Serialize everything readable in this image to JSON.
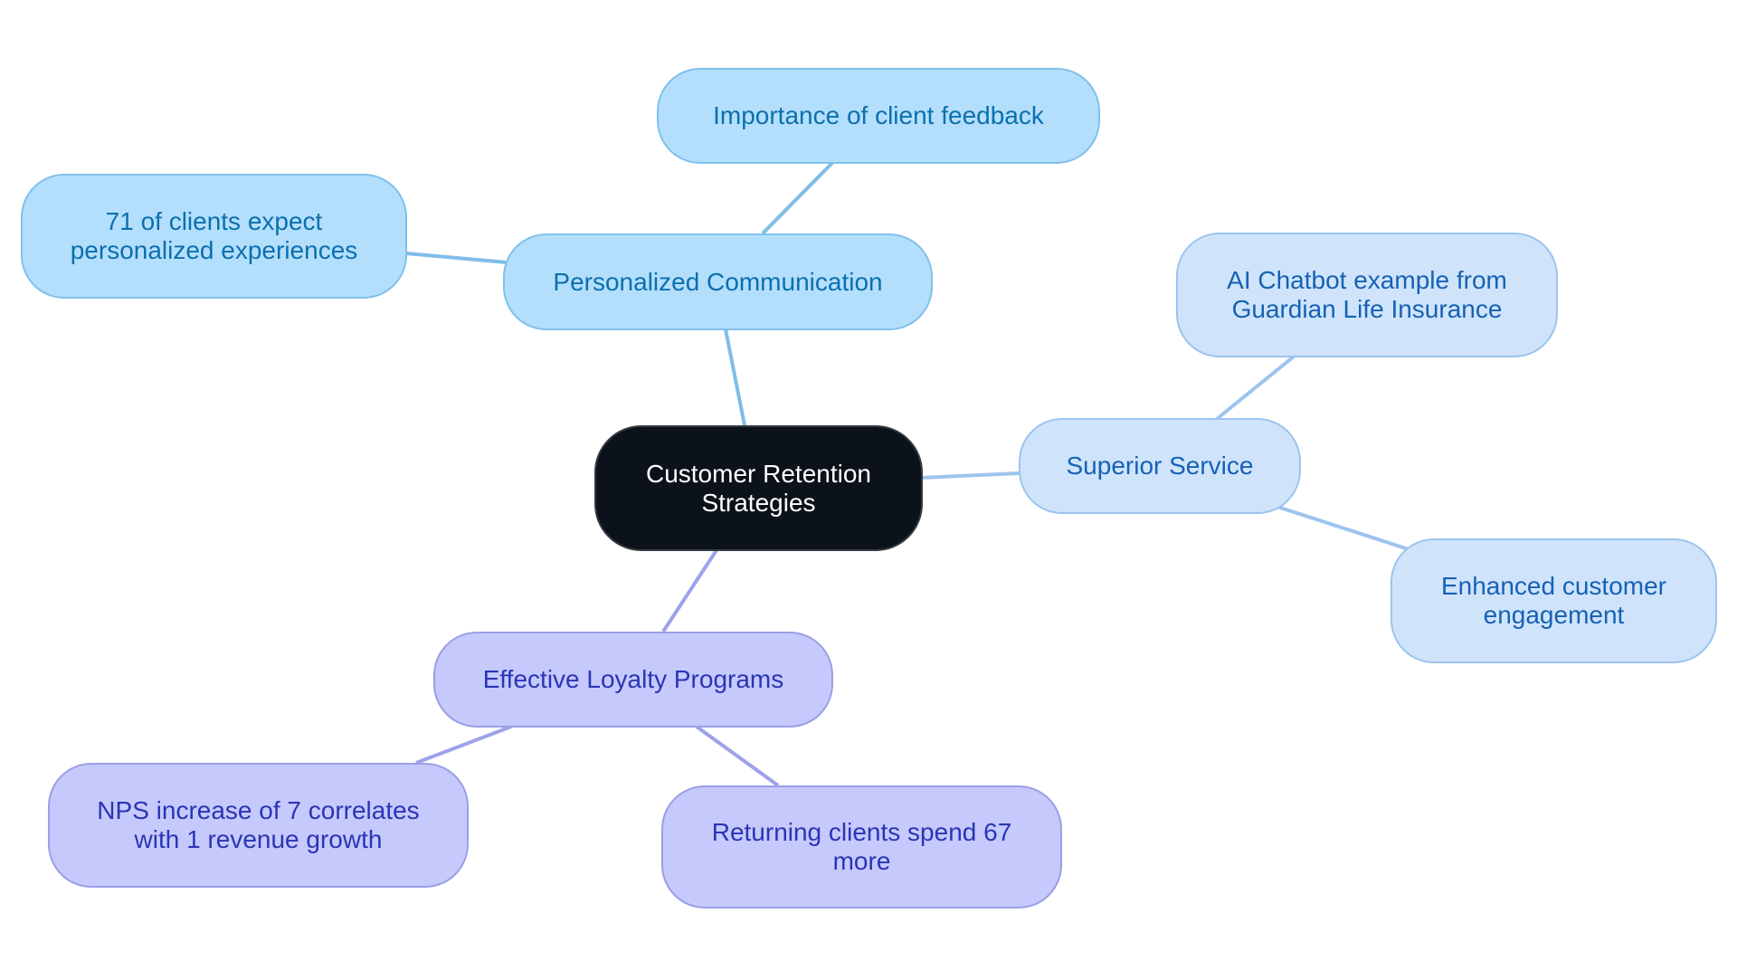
{
  "diagram": {
    "type": "mind-map",
    "root": {
      "id": "root",
      "label": "Customer Retention\nStrategies"
    },
    "colors": {
      "root_fill": "#0c1219",
      "group_personalized": {
        "fill": "#b3dffc",
        "stroke": "#82c0ea",
        "text": "#0c6fae",
        "link": "#7fbde8"
      },
      "group_service": {
        "fill": "#cfe4fb",
        "stroke": "#9cc4ee",
        "text": "#1761b4",
        "link": "#9cc4ee"
      },
      "group_loyalty": {
        "fill": "#c6c9fc",
        "stroke": "#9a9fe6",
        "text": "#2a35b4",
        "link": "#9ea2ea"
      }
    },
    "nodes": [
      {
        "id": "personalized",
        "label": "Personalized Communication",
        "parent": "root",
        "group": "group_personalized"
      },
      {
        "id": "feedback",
        "label": "Importance of client feedback",
        "parent": "personalized",
        "group": "group_personalized"
      },
      {
        "id": "expect71",
        "label": "71 of clients expect\npersonalized experiences",
        "parent": "personalized",
        "group": "group_personalized"
      },
      {
        "id": "service",
        "label": "Superior Service",
        "parent": "root",
        "group": "group_service"
      },
      {
        "id": "chatbot",
        "label": "AI Chatbot example from\nGuardian Life Insurance",
        "parent": "service",
        "group": "group_service"
      },
      {
        "id": "engagement",
        "label": "Enhanced customer\nengagement",
        "parent": "service",
        "group": "group_service"
      },
      {
        "id": "loyalty",
        "label": "Effective Loyalty Programs",
        "parent": "root",
        "group": "group_loyalty"
      },
      {
        "id": "nps",
        "label": "NPS increase of 7 correlates\nwith 1 revenue growth",
        "parent": "loyalty",
        "group": "group_loyalty"
      },
      {
        "id": "returning",
        "label": "Returning clients spend 67\nmore",
        "parent": "loyalty",
        "group": "group_loyalty"
      }
    ]
  }
}
